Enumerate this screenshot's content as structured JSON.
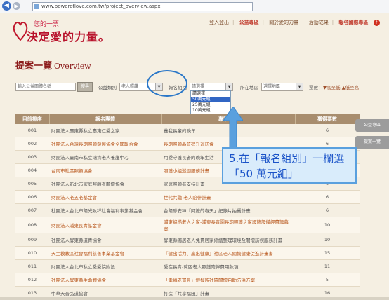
{
  "browser": {
    "url": "www.poweroflove.com.tw/project_overview.aspx"
  },
  "header": {
    "logo_top": "您的一票",
    "logo_main": "決定愛的力量。",
    "nav": [
      "登入登出",
      "公益專區",
      "關於愛的力量",
      "活動成果",
      "報名國際專區"
    ]
  },
  "page": {
    "title": "提案一覽",
    "subtitle": "Overview"
  },
  "filters": {
    "keyword_placeholder": "輸入公益團體名稱",
    "search_label": "搜尋",
    "category_label": "公益類別",
    "category_value": "老人照護",
    "group_label": "報名組別",
    "group_value": "請選擇",
    "region_label": "所在地區",
    "region_value": "選擇地區",
    "sort_label": "票數：",
    "sort_options": "▼高至低 ▲低至高"
  },
  "dropdown": {
    "options": [
      "請選擇",
      "50萬元組",
      "25萬元組",
      "10萬元組"
    ],
    "highlighted_index": 1
  },
  "table": {
    "headers": [
      "目前排序",
      "報名團體",
      "專案名稱",
      "獲得票數"
    ],
    "rows": [
      {
        "rank": "001",
        "org": "財團法人臺東縣私立臺東仁愛之家",
        "project": "養我長輩的晚年",
        "votes": "6"
      },
      {
        "rank": "002",
        "org": "社團法人台灣長期照顧發展協會全國聯合會",
        "project": "長期照顧品質提升巡訪會",
        "votes": "6"
      },
      {
        "rank": "003",
        "org": "財團法人臺南市私立鴻貴老人養護中心",
        "project": "用愛守護長者的晚年生活",
        "votes": "6"
      },
      {
        "rank": "004",
        "org": "台南市社區照顧協會",
        "project": "照護小組巡迴服務計畫",
        "votes": "6"
      },
      {
        "rank": "005",
        "org": "社團法人新北市家庭照顧者關懷協會",
        "project": "家庭照顧者支持計畫",
        "votes": "6"
      },
      {
        "rank": "006",
        "org": "財團法人老五老基金會",
        "project": "世代共融-老人陪伴計畫",
        "votes": "6"
      },
      {
        "rank": "007",
        "org": "社團法人台北市陽光致祥社會福利事業基金會",
        "project": "台陽聯安神「阿嬤的春天」紀錄片拍攝計畫",
        "votes": "6"
      },
      {
        "rank": "008",
        "org": "財團法人浦東長青基金會",
        "project": "浦東據梯老人之家-浦東長青園長期照護之家設施設備經費籌募案",
        "votes": "10"
      },
      {
        "rank": "009",
        "org": "社團法人屏東縣道青協會",
        "project": "屏東縣獨居老人免費居家修繕整理環境及關懷訪視服務計畫",
        "votes": "10"
      },
      {
        "rank": "010",
        "org": "天主教教區社會福利慈善事業基金會",
        "project": "『健出活力、贏出健康』社區老人關懷健康促進計畫書",
        "votes": "15"
      },
      {
        "rank": "011",
        "org": "財團法人台北市私立愛愛院附設...",
        "project": "愛在長青-貧困老人照護陪伴費用款項",
        "votes": "11"
      },
      {
        "rank": "012",
        "org": "社團法人屏東縣生命體協會",
        "project": "「幸福老寶貝」銀髮族社區關懷自助防治方案",
        "votes": "5"
      },
      {
        "rank": "013",
        "org": "中華天音弘道協會",
        "project": "打造『共享福田』計畫",
        "votes": "16"
      }
    ]
  },
  "callout": {
    "text": "5.在「報名組別」一欄選「50 萬元組」"
  },
  "side_tabs": [
    "公益專區",
    "提案一覽"
  ]
}
